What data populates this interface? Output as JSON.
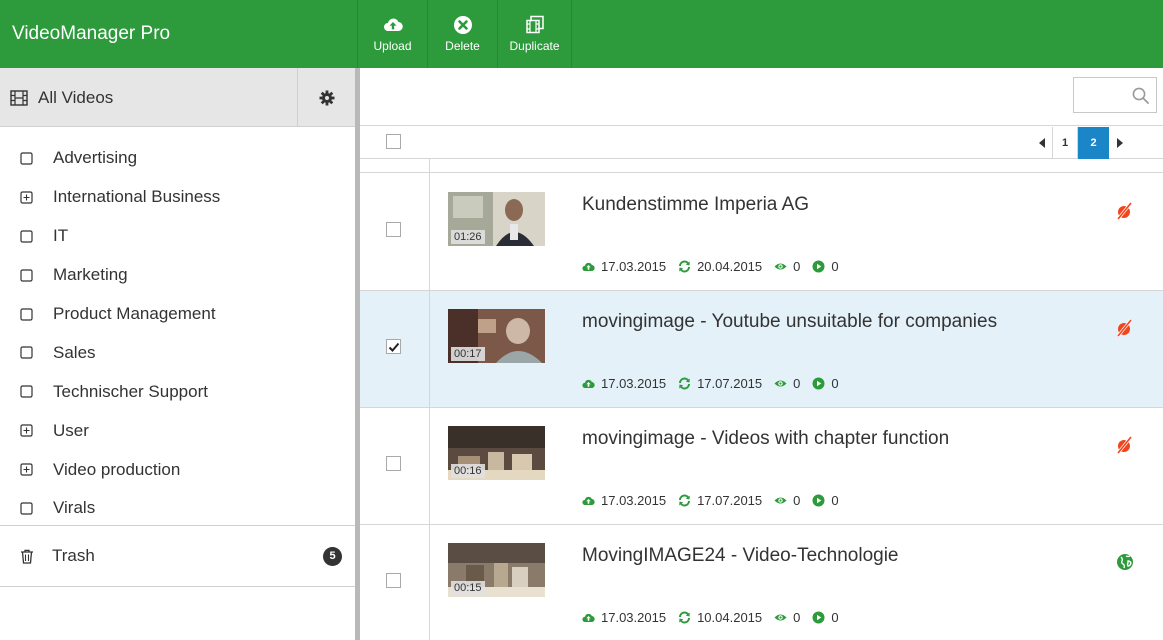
{
  "app": {
    "title": "VideoManager Pro"
  },
  "toolbar": {
    "upload_label": "Upload",
    "delete_label": "Delete",
    "duplicate_label": "Duplicate"
  },
  "sidebar": {
    "all_videos_label": "All Videos",
    "categories": [
      {
        "label": "Advertising",
        "icon": "checkbox-icon"
      },
      {
        "label": "International Business",
        "icon": "expand-plus-icon"
      },
      {
        "label": "IT",
        "icon": "checkbox-icon"
      },
      {
        "label": "Marketing",
        "icon": "checkbox-icon"
      },
      {
        "label": "Product Management",
        "icon": "checkbox-icon"
      },
      {
        "label": "Sales",
        "icon": "checkbox-icon"
      },
      {
        "label": "Technischer Support",
        "icon": "checkbox-icon"
      },
      {
        "label": "User",
        "icon": "expand-plus-icon"
      },
      {
        "label": "Video production",
        "icon": "expand-plus-icon"
      },
      {
        "label": "Virals",
        "icon": "checkbox-icon"
      }
    ],
    "trash_label": "Trash",
    "trash_count": "5"
  },
  "search": {
    "placeholder": "",
    "value": ""
  },
  "pager": {
    "pages": [
      "1",
      "2"
    ],
    "current": "2"
  },
  "videos": [
    {
      "title": "Kundenstimme Imperia AG",
      "duration": "01:26",
      "uploaded": "17.03.2015",
      "updated": "20.04.2015",
      "views": "0",
      "plays": "0",
      "selected": false,
      "status": "unpublished-icon"
    },
    {
      "title": "movingimage - Youtube unsuitable for companies",
      "duration": "00:17",
      "uploaded": "17.03.2015",
      "updated": "17.07.2015",
      "views": "0",
      "plays": "0",
      "selected": true,
      "status": "unpublished-icon"
    },
    {
      "title": "movingimage - Videos with chapter function",
      "duration": "00:16",
      "uploaded": "17.03.2015",
      "updated": "17.07.2015",
      "views": "0",
      "plays": "0",
      "selected": false,
      "status": "unpublished-icon"
    },
    {
      "title": "MovingIMAGE24 - Video-Technologie",
      "duration": "00:15",
      "uploaded": "17.03.2015",
      "updated": "10.04.2015",
      "views": "0",
      "plays": "0",
      "selected": false,
      "status": "published-globe-icon"
    }
  ],
  "colors": {
    "brand_green": "#2d9a3b",
    "meta_green": "#2d9a3b",
    "unpublished_red": "#f0461e",
    "selection_blue": "#e4f1f9",
    "pager_active": "#1a86c7"
  }
}
